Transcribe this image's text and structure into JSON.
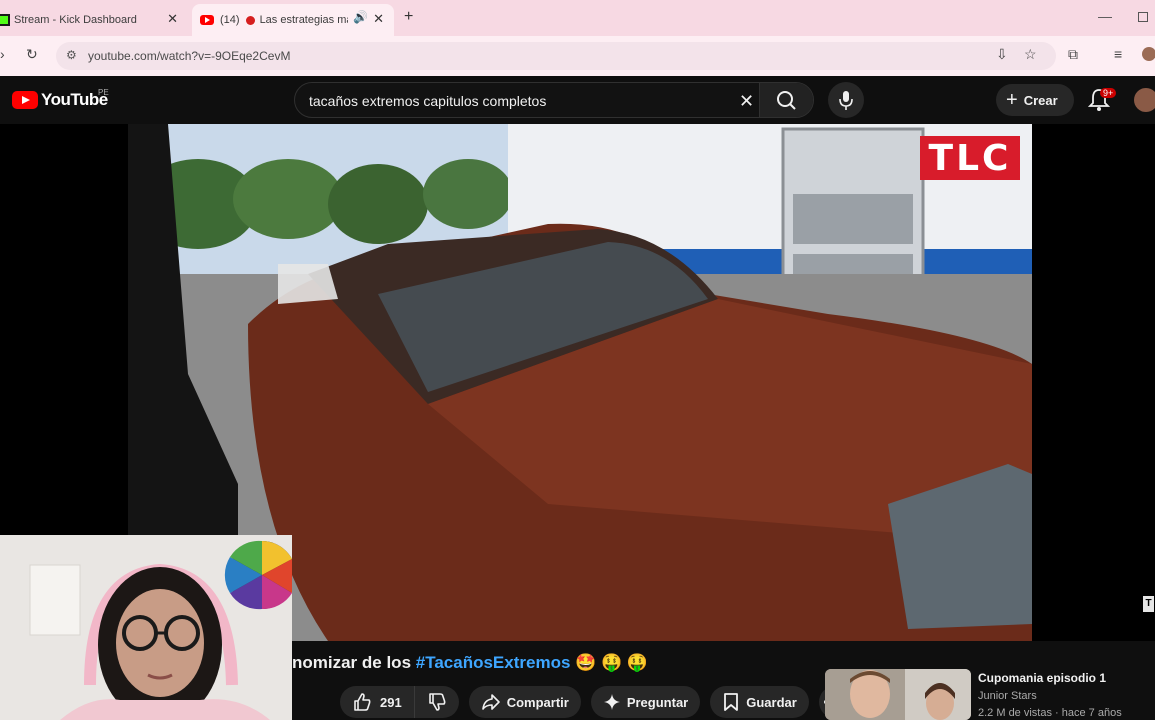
{
  "browser": {
    "tabs": [
      {
        "title": "Stream - Kick Dashboard",
        "favicon": "kick-icon"
      },
      {
        "count": "(14)",
        "title": "Las estrategias más",
        "favicon": "youtube-icon",
        "audible": true
      }
    ],
    "url": "youtube.com/watch?v=-9OEqe2CevM"
  },
  "youtube": {
    "logo_text": "YouTube",
    "region": "PE",
    "search_query": "tacaños extremos capitulos completos",
    "create_label": "Crear",
    "notifications_badge": "9+"
  },
  "video": {
    "channel_bug": "TLC",
    "title_prefix": "nomizar de los",
    "title_hashtag": "#TacañosExtremos",
    "title_emoji": "🤩 🤑 🤑",
    "likes": "291",
    "share_label": "Compartir",
    "ask_label": "Preguntar",
    "save_label": "Guardar"
  },
  "recommendation": {
    "title": "Cupomania episodio 1",
    "channel": "Junior Stars",
    "meta": "2.2 M de vistas · hace 7 años"
  },
  "colors": {
    "accent_red": "#ff0000",
    "hashtag_blue": "#3ea6ff",
    "tab_strip_pink": "#f7d9e3",
    "tlc_red": "#d81c2b"
  }
}
